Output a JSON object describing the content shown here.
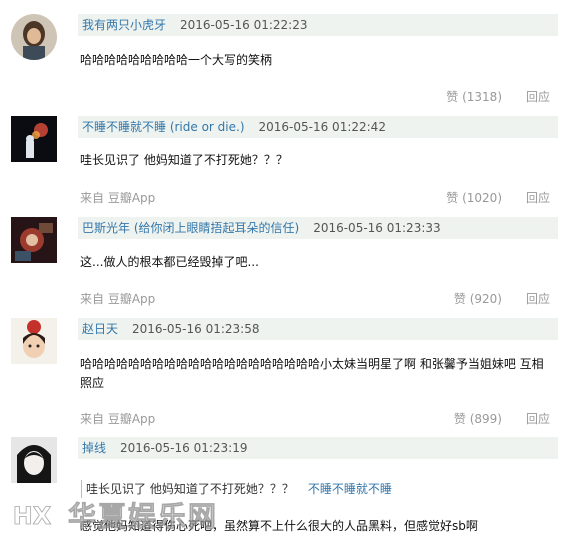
{
  "comments": [
    {
      "author": "我有两只小虎牙",
      "timestamp": "2016-05-16 01:22:23",
      "text": "哈哈哈哈哈哈哈哈哈一个大写的笑柄",
      "source": "",
      "votes": "赞 (1318)",
      "reply": "回应"
    },
    {
      "author": "不睡不睡就不睡 (ride or die.)",
      "timestamp": "2016-05-16 01:22:42",
      "text": "哇长见识了 他妈知道了不打死她？？？",
      "source": "来自 豆瓣App",
      "votes": "赞 (1020)",
      "reply": "回应"
    },
    {
      "author": "巴斯光年 (给你闭上眼睛捂起耳朵的信任)",
      "timestamp": "2016-05-16 01:23:33",
      "text": "这...做人的根本都已经毁掉了吧...",
      "source": "来自 豆瓣App",
      "votes": "赞 (920)",
      "reply": "回应"
    },
    {
      "author": "赵日天",
      "timestamp": "2016-05-16 01:23:58",
      "text": "哈哈哈哈哈哈哈哈哈哈哈哈哈哈哈哈哈哈哈哈小太妹当明星了啊 和张馨予当姐妹吧 互相照应",
      "source": "来自 豆瓣App",
      "votes": "赞 (899)",
      "reply": "回应"
    },
    {
      "author": "掉线",
      "timestamp": "2016-05-16 01:23:19",
      "quote_text": "哇长见识了 他妈知道了不打死她？？？",
      "quote_author": "不睡不睡就不睡",
      "text": "感觉他妈知道得伤心死吧，虽然算不上什么很大的人品黑料，但感觉好sb啊"
    }
  ],
  "watermark": {
    "text": "华夏娱乐网"
  },
  "colors": {
    "link": "#3377aa",
    "meta": "#999999",
    "header_bg": "#eef3ef"
  }
}
